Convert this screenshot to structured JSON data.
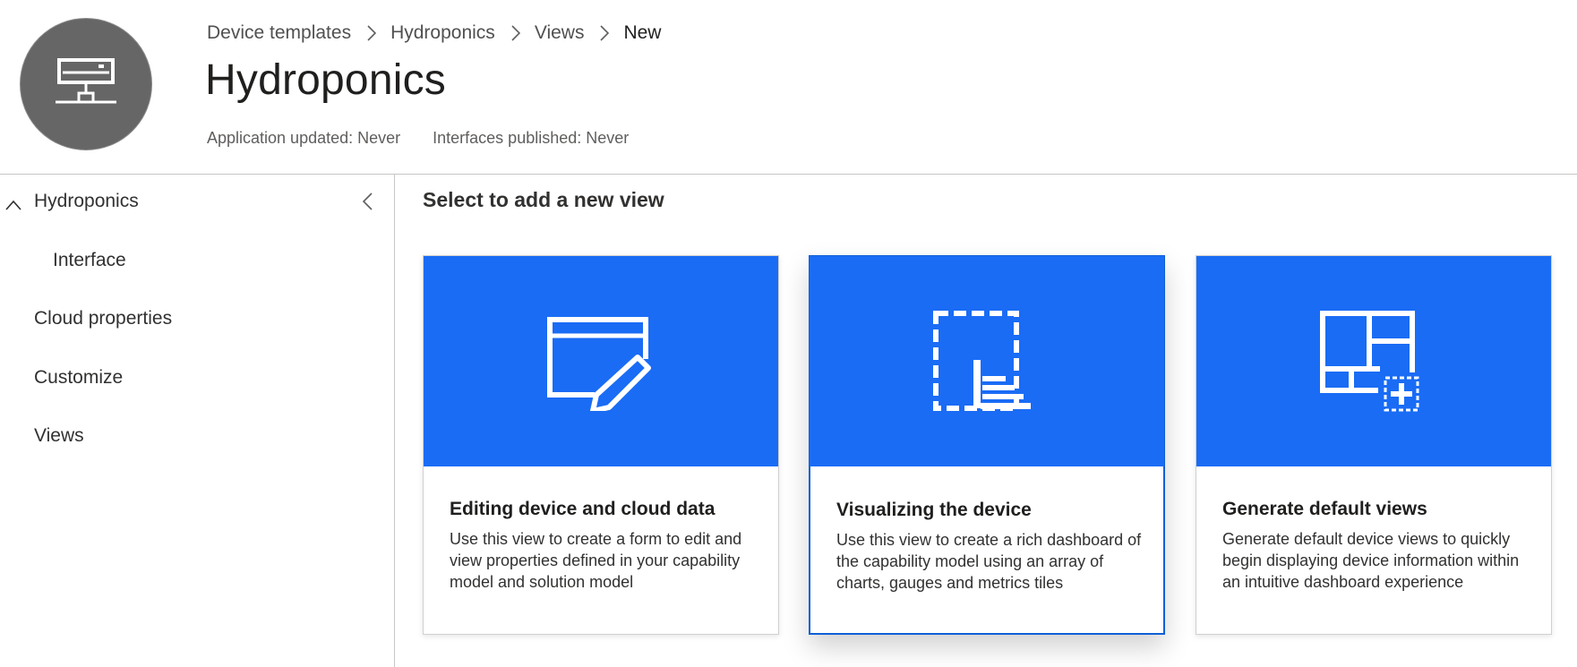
{
  "header": {
    "breadcrumb": [
      "Device templates",
      "Hydroponics",
      "Views",
      "New"
    ],
    "title": "Hydroponics",
    "app_updated": "Application updated: Never",
    "interfaces_published": "Interfaces published: Never",
    "avatar_icon": "device-network-icon"
  },
  "sidebar": {
    "root": "Hydroponics",
    "items": [
      "Interface",
      "Cloud properties",
      "Customize",
      "Views"
    ]
  },
  "main": {
    "section_title": "Select to add a new view",
    "cards": [
      {
        "title": "Editing device and cloud data",
        "description": "Use this view to create a form to edit and view properties defined in your capability model and solution model",
        "icon": "form-edit-icon"
      },
      {
        "title": "Visualizing the device",
        "description": "Use this view to create a rich dashboard of the capability model using an array of charts, gauges and metrics tiles",
        "icon": "dashboard-chart-icon"
      },
      {
        "title": "Generate default views",
        "description": "Generate default device views to quickly begin displaying device information within an intuitive dashboard experience",
        "icon": "tiles-add-icon"
      }
    ]
  },
  "colors": {
    "accent": "#1a6cf5",
    "selected_border": "#0f5fd6",
    "avatar": "#666666"
  }
}
